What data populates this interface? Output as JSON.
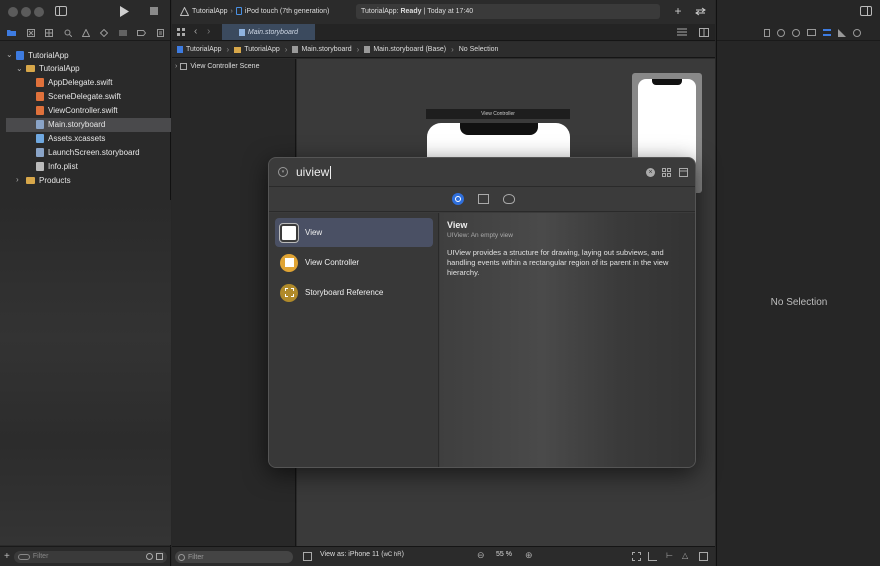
{
  "toolbar": {
    "scheme": "TutorialApp",
    "device": "iPod touch (7th generation)",
    "status_app": "TutorialApp: ",
    "status_state": "Ready",
    "status_sep": " | ",
    "status_time": "Today at 17:40"
  },
  "tab": {
    "label": "Main.storyboard"
  },
  "breadcrumb": [
    "TutorialApp",
    "TutorialApp",
    "Main.storyboard",
    "Main.storyboard (Base)",
    "No Selection"
  ],
  "navigator": {
    "items": [
      {
        "label": "TutorialApp",
        "indent": 0,
        "type": "project",
        "expanded": true
      },
      {
        "label": "TutorialApp",
        "indent": 1,
        "type": "folder",
        "expanded": true
      },
      {
        "label": "AppDelegate.swift",
        "indent": 2,
        "type": "swift"
      },
      {
        "label": "SceneDelegate.swift",
        "indent": 2,
        "type": "swift"
      },
      {
        "label": "ViewController.swift",
        "indent": 2,
        "type": "swift"
      },
      {
        "label": "Main.storyboard",
        "indent": 2,
        "type": "storyboard",
        "selected": true
      },
      {
        "label": "Assets.xcassets",
        "indent": 2,
        "type": "assets"
      },
      {
        "label": "LaunchScreen.storyboard",
        "indent": 2,
        "type": "storyboard"
      },
      {
        "label": "Info.plist",
        "indent": 2,
        "type": "plist"
      },
      {
        "label": "Products",
        "indent": 1,
        "type": "folder",
        "expanded": false
      }
    ],
    "filter_placeholder": "Filter"
  },
  "outline": {
    "scene": "View Controller Scene",
    "filter_placeholder": "Filter"
  },
  "canvas": {
    "vc_title": "View Controller",
    "view_as": "View as: iPhone 11 (",
    "view_as_keys": "wC hR",
    "view_as_end": ")",
    "zoom": "55 %"
  },
  "library": {
    "search_value": "uiview",
    "items": [
      {
        "label": "View",
        "selected": true
      },
      {
        "label": "View Controller",
        "selected": false
      },
      {
        "label": "Storyboard Reference",
        "selected": false
      }
    ],
    "detail": {
      "title": "View",
      "subtitle": "UIView: An empty view",
      "description": "UIView provides a structure for drawing, laying out subviews, and handling events within a rectangular region of its parent in the view hierarchy."
    }
  },
  "inspector": {
    "empty_label": "No Selection"
  },
  "colors": {
    "accent": "#2f6fdc",
    "folder": "#d7a74a",
    "selected_row": "#4a4a4c",
    "vc_icon": "#e0a434"
  }
}
